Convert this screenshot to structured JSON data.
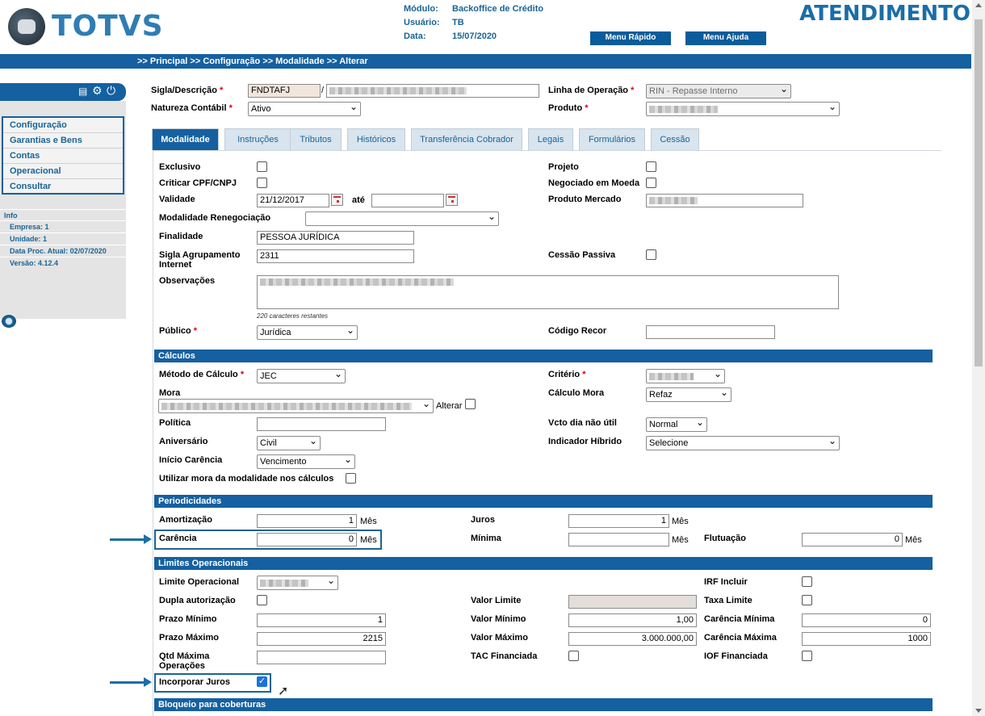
{
  "header": {
    "logo_text": "TOTVS",
    "modulo_label": "Módulo:",
    "modulo_value": "Backoffice de Crédito",
    "usuario_label": "Usuário:",
    "usuario_value": "TB",
    "data_label": "Data:",
    "data_value": "15/07/2020",
    "app_title": "ATENDIMENTO",
    "menu_rapido": "Menu Rápido",
    "menu_ajuda": "Menu Ajuda"
  },
  "breadcrumb": ">> Principal >> Configuração >> Modalidade >> Alterar",
  "sidebar": {
    "menu": [
      "Configuração",
      "Garantias e Bens",
      "Contas",
      "Operacional",
      "Consultar"
    ],
    "info_title": "Info",
    "info": [
      "Empresa: 1",
      "Unidade: 1",
      "Data Proc. Atual: 02/07/2020",
      "Versão: 4.12.4"
    ]
  },
  "top_form": {
    "sigla_label": "Sigla/Descrição",
    "sigla_value": "FNDTAFJ",
    "slash": "/",
    "linha_label": "Linha de Operação",
    "linha_value": "RIN - Repasse Interno",
    "natureza_label": "Natureza Contábil",
    "natureza_value": "Ativo",
    "produto_label": "Produto"
  },
  "tabs": [
    "Modalidade",
    "Instruções",
    "Tributos",
    "Históricos",
    "Transferência Cobrador",
    "Legais",
    "Formulários",
    "Cessão"
  ],
  "modalidade": {
    "exclusivo": "Exclusivo",
    "projeto": "Projeto",
    "criticar": "Criticar CPF/CNPJ",
    "negociado": "Negociado em Moeda",
    "validade": "Validade",
    "validade_value": "21/12/2017",
    "ate": "até",
    "produto_mercado": "Produto Mercado",
    "mod_reneg": "Modalidade Renegociação",
    "finalidade": "Finalidade",
    "finalidade_value": "PESSOA JURÍDICA",
    "sigla_agrup": "Sigla Agrupamento Internet",
    "sigla_agrup_value": "2311",
    "cessao_passiva": "Cessão Passiva",
    "observacoes": "Observações",
    "caracteres": "220 caracteres restantes",
    "publico": "Público",
    "publico_value": "Jurídica",
    "codigo_recor": "Código Recor"
  },
  "calculos": {
    "title": "Cálculos",
    "metodo": "Método de Cálculo",
    "metodo_value": "JEC",
    "criterio": "Critério",
    "mora": "Mora",
    "alterar": "Alterar",
    "calculo_mora": "Cálculo Mora",
    "calculo_mora_value": "Refaz",
    "politica": "Política",
    "vcto": "Vcto dia não útil",
    "vcto_value": "Normal",
    "aniversario": "Aniversário",
    "aniversario_value": "Civil",
    "indicador": "Indicador Híbrido",
    "indicador_value": "Selecione",
    "inicio_carencia": "Início Carência",
    "inicio_carencia_value": "Vencimento",
    "utilizar_mora": "Utilizar mora da modalidade nos cálculos"
  },
  "periodicidades": {
    "title": "Periodicidades",
    "amortizacao": "Amortização",
    "amortizacao_value": "1",
    "juros": "Juros",
    "juros_value": "1",
    "carencia": "Carência",
    "carencia_value": "0",
    "minima": "Mínima",
    "flutuacao": "Flutuação",
    "flutuacao_value": "0",
    "mes": "Mês"
  },
  "limites": {
    "title": "Limites Operacionais",
    "limite_op": "Limite Operacional",
    "irf": "IRF Incluir",
    "dupla": "Dupla autorização",
    "valor_limite": "Valor Limite",
    "taxa_limite": "Taxa Limite",
    "prazo_min": "Prazo Mínimo",
    "prazo_min_value": "1",
    "valor_min": "Valor Mínimo",
    "valor_min_value": "1,00",
    "carencia_min": "Carência Mínima",
    "carencia_min_value": "0",
    "prazo_max": "Prazo Máximo",
    "prazo_max_value": "2215",
    "valor_max": "Valor Máximo",
    "valor_max_value": "3.000.000,00",
    "carencia_max": "Carência Máxima",
    "carencia_max_value": "1000",
    "qtd_max": "Qtd Máxima Operações",
    "tac": "TAC Financiada",
    "iof": "IOF Financiada",
    "incorporar": "Incorporar Juros"
  },
  "bloqueio": {
    "title": "Bloqueio para coberturas"
  },
  "colors": {
    "brand_blue": "#1560a0",
    "logo_blue": "#2f7db3",
    "required": "#d9001b"
  }
}
